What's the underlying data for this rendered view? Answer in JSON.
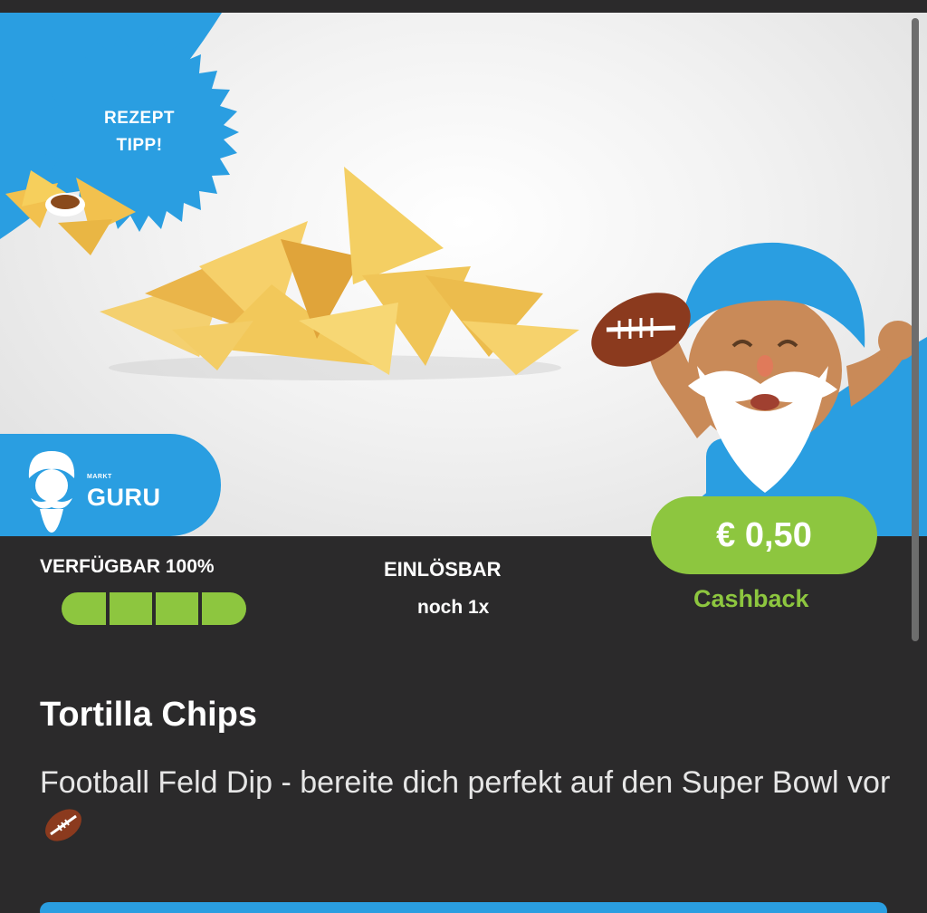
{
  "badge": {
    "line1": "REZEPT",
    "line2": "TIPP!"
  },
  "brand": {
    "small": "MARKT",
    "name": "GURU"
  },
  "availability": {
    "label": "VERFÜGBAR 100%",
    "percent": 100,
    "segments": 4
  },
  "redeem": {
    "label": "EINLÖSBAR",
    "count": "noch 1x"
  },
  "offer": {
    "price": "€ 0,50",
    "type": "Cashback"
  },
  "product": {
    "title": "Tortilla Chips",
    "description": "Football Feld Dip - bereite dich perfekt auf den Super Bowl vor"
  },
  "colors": {
    "accent_blue": "#2a9ee1",
    "accent_green": "#8dc63f",
    "background_dark": "#2b2a2b"
  }
}
